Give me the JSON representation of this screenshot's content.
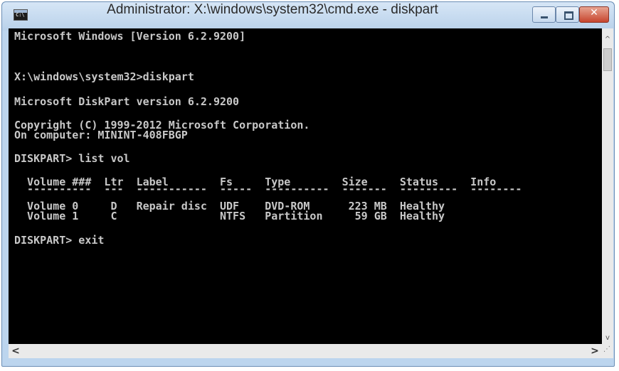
{
  "window": {
    "title": "Administrator: X:\\windows\\system32\\cmd.exe - diskpart"
  },
  "console": {
    "lines": [
      "Microsoft Windows [Version 6.2.9200]",
      "",
      "X:\\windows\\system32>diskpart",
      "",
      "Microsoft DiskPart version 6.2.9200",
      "",
      "Copyright (C) 1999-2012 Microsoft Corporation.",
      "On computer: MININT-408FBGP",
      "",
      "DISKPART> list vol",
      "",
      "  Volume ###  Ltr  Label        Fs     Type        Size     Status     Info",
      "  ----------  ---  -----------  -----  ----------  -------  ---------  --------",
      "  Volume 0     D   Repair disc  UDF    DVD-ROM      223 MB  Healthy",
      "  Volume 1     C                NTFS   Partition     59 GB  Healthy",
      "",
      "DISKPART> exit"
    ]
  },
  "scrollbar": {
    "up_arrow": "^",
    "down_arrow": "v",
    "left_arrow": "<",
    "right_arrow": ">"
  }
}
